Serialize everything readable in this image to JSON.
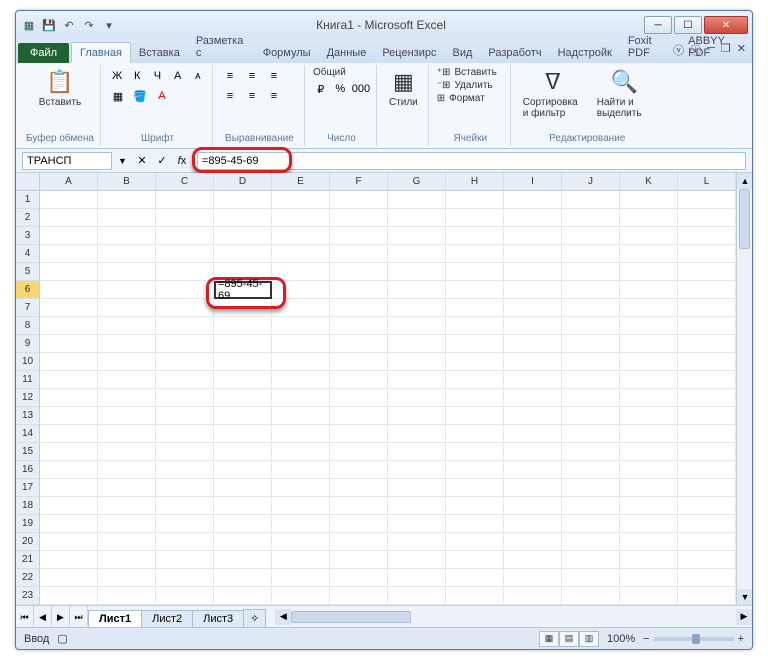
{
  "title": "Книга1 - Microsoft Excel",
  "tabs": {
    "file": "Файл",
    "items": [
      "Главная",
      "Вставка",
      "Разметка с",
      "Формулы",
      "Данные",
      "Рецензирс",
      "Вид",
      "Разработч",
      "Надстройк",
      "Foxit PDF",
      "ABBYY PDF"
    ],
    "active": 0
  },
  "ribbon": {
    "clipboard": {
      "label": "Буфер обмена",
      "paste": "Вставить"
    },
    "font": {
      "label": "Шрифт",
      "bold": "Ж",
      "italic": "К",
      "underline": "Ч"
    },
    "alignment": {
      "label": "Выравнивание"
    },
    "number": {
      "label": "Число",
      "format": "Общий"
    },
    "styles": {
      "label": "Стили",
      "btn": "Стили"
    },
    "cells": {
      "label": "Ячейки",
      "insert": "Вставить",
      "delete": "Удалить",
      "format": "Формат"
    },
    "editing": {
      "label": "Редактирование",
      "sort": "Сортировка и фильтр",
      "find": "Найти и выделить"
    }
  },
  "namebox": "ТРАНСП",
  "formula": "=895-45-69",
  "columns": [
    "A",
    "B",
    "C",
    "D",
    "E",
    "F",
    "G",
    "H",
    "I",
    "J",
    "K",
    "L"
  ],
  "rows_count": 23,
  "active_cell": {
    "row": 6,
    "col": "D",
    "value": "=895-45-69"
  },
  "sheets": {
    "items": [
      "Лист1",
      "Лист2",
      "Лист3"
    ],
    "active": 0
  },
  "status": {
    "mode": "Ввод",
    "zoom": "100%"
  }
}
